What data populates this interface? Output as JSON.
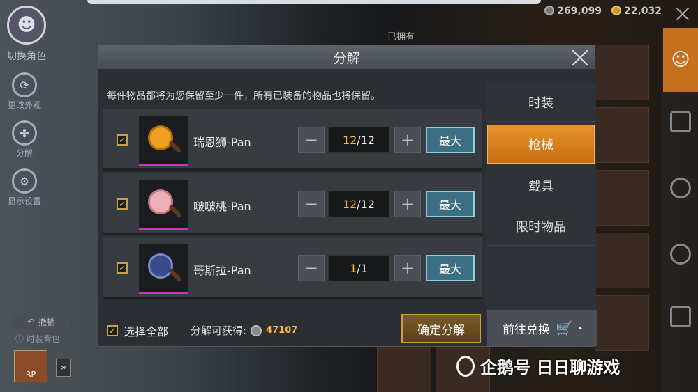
{
  "hud": {
    "bp_amount": "269,099",
    "uc_amount": "22,032"
  },
  "left_menu": {
    "switch_role": "切换角色",
    "change_look": "更改外观",
    "decompose": "分解",
    "display_settings": "显示设置",
    "undo": "撤销",
    "outfit_bag": "时装背包",
    "rp_label": "RP"
  },
  "inventory": {
    "owned_label": "已拥有"
  },
  "modal": {
    "title": "分解",
    "notice": "每件物品都将为您保留至少一件，所有已装备的物品也将保留。",
    "items": [
      {
        "name": "瑞恩狮-Pan",
        "qty_current": "12",
        "qty_total": "/12",
        "max_label": "最大",
        "color": "#f0a020"
      },
      {
        "name": "啵啵桃-Pan",
        "qty_current": "12",
        "qty_total": "/12",
        "max_label": "最大",
        "color": "#f0b0b8"
      },
      {
        "name": "哥斯拉-Pan",
        "qty_current": "1",
        "qty_total": "/1",
        "max_label": "最大",
        "color": "#3a4a8a"
      }
    ],
    "select_all": "选择全部",
    "gain_label": "分解可获得:",
    "gain_value": "47107",
    "confirm": "确定分解"
  },
  "categories": [
    {
      "label": "时装",
      "active": false
    },
    {
      "label": "枪械",
      "active": true
    },
    {
      "label": "载具",
      "active": false
    },
    {
      "label": "限时物品",
      "active": false
    }
  ],
  "exchange": {
    "label": "前往兑换",
    "icon": "cart-icon"
  },
  "watermark": {
    "text": "企鹅号 日日聊游戏"
  }
}
